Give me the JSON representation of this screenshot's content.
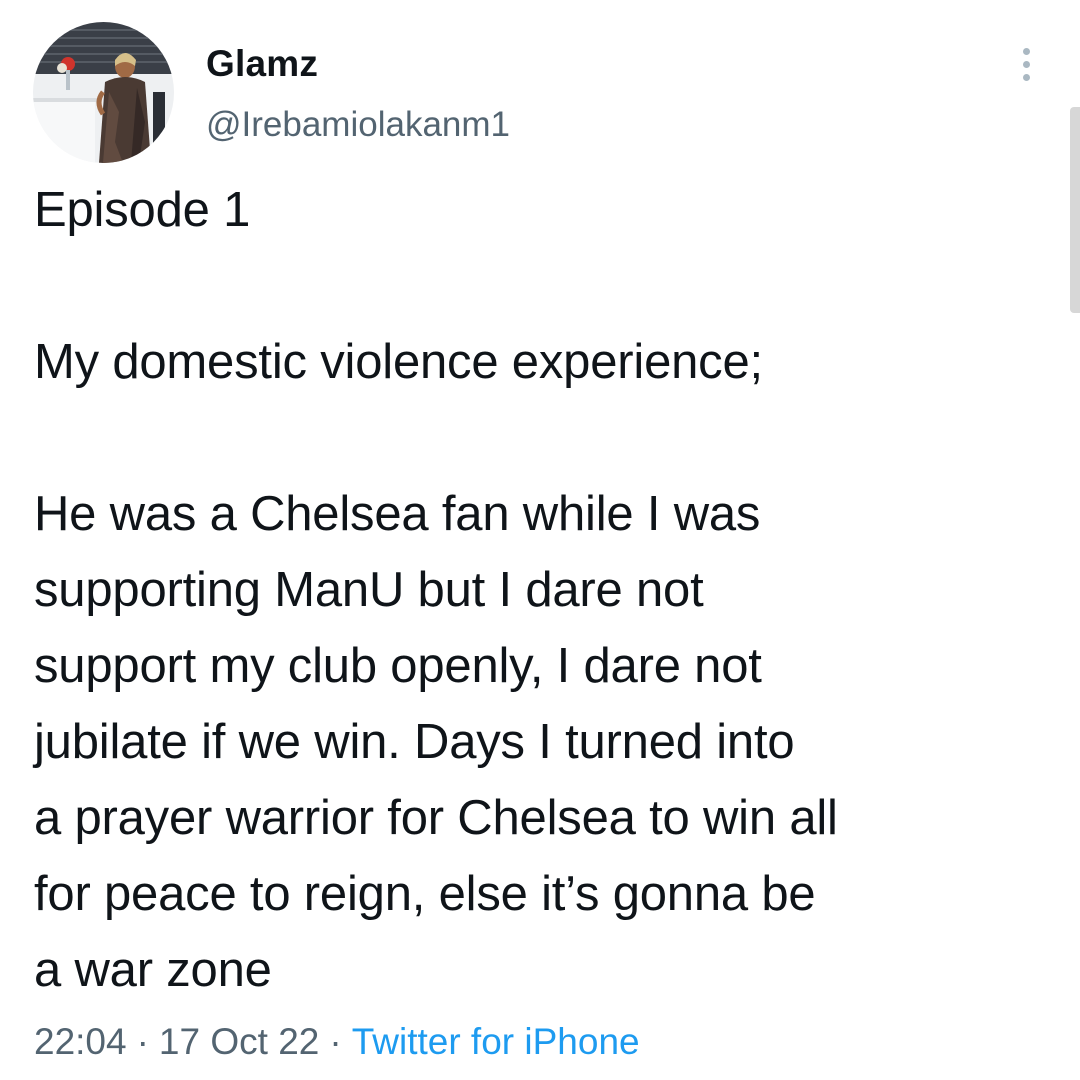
{
  "tweet": {
    "author": {
      "display_name": "Glamz",
      "handle": "@Irebamiolakanm1"
    },
    "paragraphs": [
      "Episode 1",
      "My domestic violence experience;",
      "He was a Chelsea fan while I was\nsupporting ManU but I dare not\nsupport my club openly, I dare not\njubilate if we win. Days I turned into\na prayer warrior for Chelsea to win all\nfor peace to reign, else it’s gonna be\na war zone"
    ],
    "meta": {
      "time": "22:04",
      "date": "17 Oct 22",
      "separator": "·",
      "source": "Twitter for iPhone"
    }
  },
  "icons": {
    "more": "more-vertical-icon",
    "avatar": "profile-photo"
  },
  "colors": {
    "text": "#0f1419",
    "secondary": "#536471",
    "link": "#1d9bf0"
  }
}
